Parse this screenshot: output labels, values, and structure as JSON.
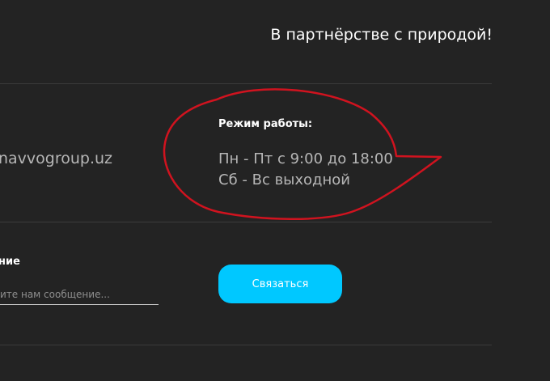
{
  "header": {
    "tagline": "В партнёрстве с природой!"
  },
  "contacts": {
    "email_fragment": "navvogroup.uz"
  },
  "hours": {
    "title": "Режим работы:",
    "weekdays": "Пн - Пт с 9:00 до 18:00",
    "weekend": "Сб - Вс выходной"
  },
  "form": {
    "message_label_fragment": "ние",
    "message_placeholder": "ите нам сообщение...",
    "submit_label": "Связаться"
  },
  "colors": {
    "background": "#232323",
    "accent_button": "#00c8ff",
    "annotation": "#d0131f"
  }
}
